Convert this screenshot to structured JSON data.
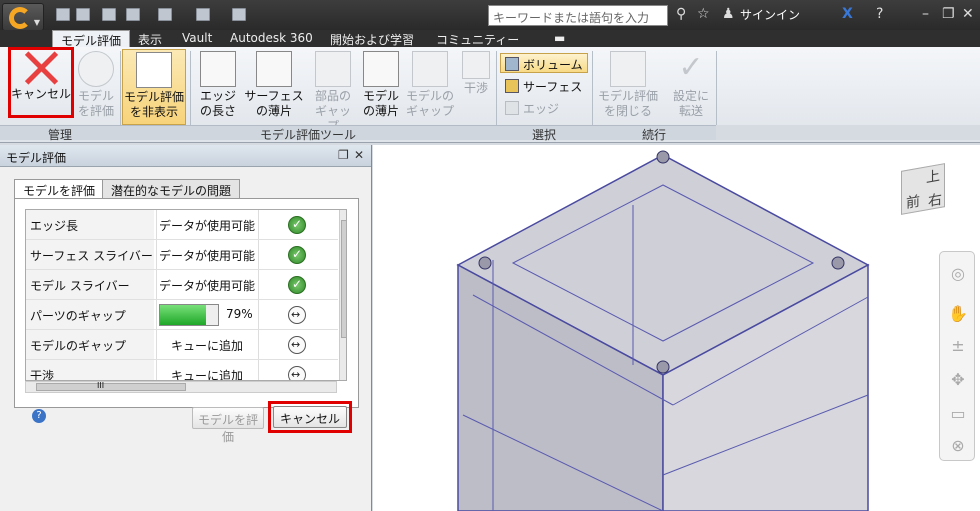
{
  "topbar": {
    "search_placeholder": "キーワードまたは語句を入力",
    "signin": "サインイン"
  },
  "tabs": [
    "モデル評価",
    "表示",
    "Vault",
    "Autodesk 360",
    "開始および学習",
    "コミュニティー"
  ],
  "ribbon": {
    "cancel": "キャンセル",
    "evaluate": [
      "モデル",
      "を評価"
    ],
    "hide": [
      "モデル評価",
      "を非表示"
    ],
    "edge_length": [
      "エッジ",
      "の長さ"
    ],
    "surface_sliver": [
      "サーフェス",
      "の薄片"
    ],
    "part_gap": [
      "部品の",
      "ギャップ"
    ],
    "model_sliver": [
      "モデル",
      "の薄片"
    ],
    "model_gap": [
      "モデルの",
      "ギャップ"
    ],
    "interference": "干渉",
    "volume": "ボリューム",
    "surface": "サーフェス",
    "edge": "エッジ",
    "close_eval": [
      "モデル評価",
      "を閉じる"
    ],
    "transfer": [
      "設定に",
      "転送"
    ],
    "panels": {
      "manage": "管理",
      "tools": "モデル評価ツール",
      "select": "選択",
      "continue": "続行"
    }
  },
  "panel": {
    "title": "モデル評価",
    "tab1": "モデルを評価",
    "tab2": "潜在的なモデルの問題",
    "rows": [
      {
        "name": "エッジ長",
        "status": "データが使用可能",
        "icon": "check-icon"
      },
      {
        "name": "サーフェス スライバー",
        "status": "データが使用可能",
        "icon": "check-icon"
      },
      {
        "name": "モデル スライバー",
        "status": "データが使用可能",
        "icon": "check-icon"
      },
      {
        "name": "パーツのギャップ",
        "status": "79%",
        "icon": "swap-icon",
        "progress": 0.79
      },
      {
        "name": "モデルのギャップ",
        "status": "キューに追加",
        "icon": "swap-icon"
      },
      {
        "name": "干渉",
        "status": "キューに追加",
        "icon": "swap-icon"
      }
    ],
    "btn_eval": "モデルを評価",
    "btn_cancel": "キャンセル",
    "scroll_mark": "III"
  },
  "viewcube": {
    "top": "上",
    "front": "前",
    "right": "右"
  }
}
